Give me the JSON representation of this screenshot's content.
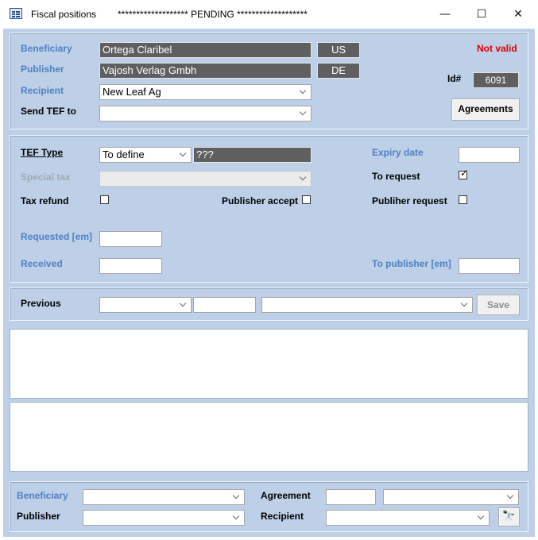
{
  "window": {
    "title": "Fiscal positions",
    "status": "******************* PENDING *******************",
    "minimize_glyph": "—",
    "maximize_glyph": "☐",
    "close_glyph": "✕"
  },
  "parties": {
    "beneficiary_label": "Beneficiary",
    "beneficiary_value": "Ortega Claribel",
    "beneficiary_country": "US",
    "publisher_label": "Publisher",
    "publisher_value": "Vajosh Verlag Gmbh",
    "publisher_country": "DE",
    "recipient_label": "Recipient",
    "recipient_value": "New Leaf Ag",
    "send_tef_label": "Send TEF to",
    "send_tef_value": "",
    "validity": "Not valid",
    "id_label": "Id#",
    "id_value": "6091",
    "agreements_button": "Agreements"
  },
  "tef": {
    "tef_type_label": "TEF Type",
    "tef_type_value": "To define",
    "tef_type_code": "???",
    "special_tax_label": "Special tax",
    "tax_refund_label": "Tax refund",
    "publisher_accept_label": "Publisher accept",
    "expiry_label": "Expiry date",
    "to_request_label": "To request",
    "to_request_checked": true,
    "publisher_request_label": "Publiher request",
    "requested_label": "Requested [em]",
    "received_label": "Received",
    "to_publisher_label": "To publisher [em]"
  },
  "previous": {
    "label": "Previous",
    "save_button": "Save"
  },
  "filters": {
    "beneficiary_label": "Beneficiary",
    "publisher_label": "Publisher",
    "agreement_label": "Agreement",
    "recipient_label": "Recipient",
    "search_icon": "binoculars-icon",
    "search_glyph": "🔭"
  },
  "colors": {
    "form_background": "#bdd0e7",
    "label_blue": "#4f80c4",
    "invalid_red": "#e00000",
    "dark_field": "#5f5f5f"
  }
}
